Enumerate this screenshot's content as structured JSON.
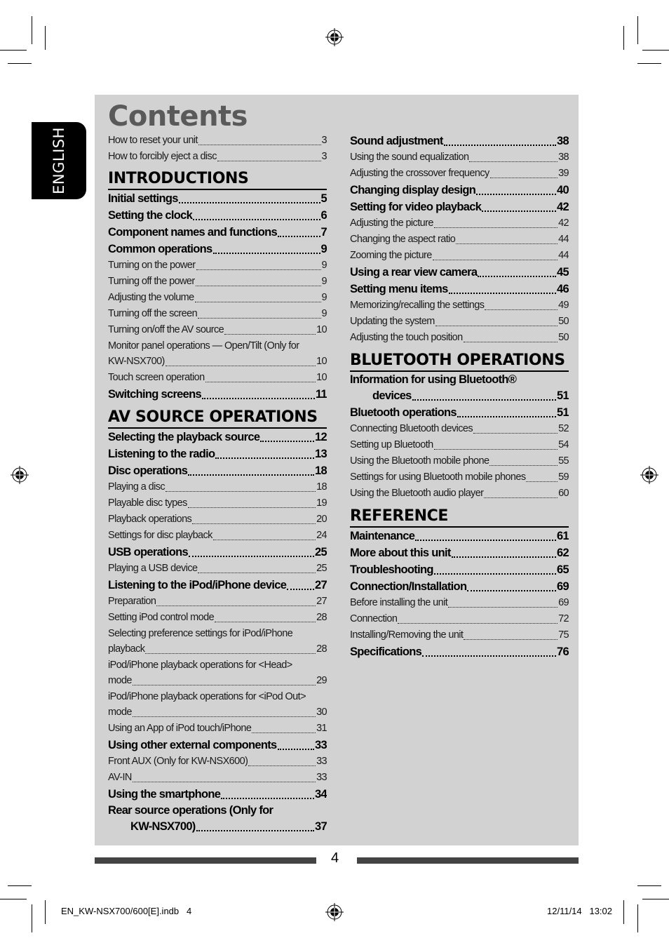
{
  "page": {
    "title": "Contents",
    "language_tab": "ENGLISH",
    "page_number": "4",
    "footer_left": "EN_KW-NSX700/600[E].indb   4",
    "footer_right": "12/11/14   13:02",
    "colors": {
      "panel": "#d2d2d2",
      "title": "#5a5a5a",
      "bar": "#444444",
      "tab": "#000000"
    }
  },
  "left_column": {
    "intro_entries": [
      {
        "label": "How to reset your unit",
        "page": "3",
        "style": "sub"
      },
      {
        "label": "How to forcibly eject a disc",
        "page": "3",
        "style": "sub"
      }
    ],
    "sections": [
      {
        "heading": "INTRODUCTIONS",
        "entries": [
          {
            "label": "Initial settings",
            "page": "5",
            "style": "main"
          },
          {
            "label": "Setting the clock",
            "page": "6",
            "style": "main"
          },
          {
            "label": "Component names and functions",
            "page": "7",
            "style": "main"
          },
          {
            "label": "Common operations",
            "page": "9",
            "style": "main"
          },
          {
            "label": "Turning on the power",
            "page": "9",
            "style": "sub"
          },
          {
            "label": "Turning off the power",
            "page": "9",
            "style": "sub"
          },
          {
            "label": "Adjusting the volume",
            "page": "9",
            "style": "sub"
          },
          {
            "label": "Turning off the screen",
            "page": "9",
            "style": "sub"
          },
          {
            "label": "Turning on/off the AV source",
            "page": "10",
            "style": "sub"
          },
          {
            "label": "Monitor panel operations — Open/Tilt (Only for",
            "page": "",
            "style": "sub-first"
          },
          {
            "label": "KW-NSX700)",
            "page": "10",
            "style": "sub"
          },
          {
            "label": "Touch screen operation",
            "page": "10",
            "style": "sub"
          },
          {
            "label": "Switching screens",
            "page": "11",
            "style": "main"
          }
        ]
      },
      {
        "heading": "AV SOURCE OPERATIONS",
        "entries": [
          {
            "label": "Selecting the playback source",
            "page": "12",
            "style": "main"
          },
          {
            "label": "Listening to the radio",
            "page": "13",
            "style": "main"
          },
          {
            "label": "Disc operations",
            "page": "18",
            "style": "main"
          },
          {
            "label": "Playing a disc",
            "page": "18",
            "style": "sub"
          },
          {
            "label": "Playable disc types",
            "page": "19",
            "style": "sub"
          },
          {
            "label": "Playback operations",
            "page": "20",
            "style": "sub"
          },
          {
            "label": "Settings for disc playback",
            "page": "24",
            "style": "sub"
          },
          {
            "label": "USB operations",
            "page": "25",
            "style": "main"
          },
          {
            "label": "Playing a USB device",
            "page": "25",
            "style": "sub"
          },
          {
            "label": "Listening to the iPod/iPhone device",
            "page": "27",
            "style": "main"
          },
          {
            "label": "Preparation",
            "page": "27",
            "style": "sub"
          },
          {
            "label": "Setting iPod control mode",
            "page": "28",
            "style": "sub"
          },
          {
            "label": "Selecting preference settings for iPod/iPhone",
            "page": "",
            "style": "sub-first"
          },
          {
            "label": "playback",
            "page": "28",
            "style": "sub"
          },
          {
            "label": "iPod/iPhone playback operations for <Head>",
            "page": "",
            "style": "sub-first"
          },
          {
            "label": "mode",
            "page": "29",
            "style": "sub"
          },
          {
            "label": "iPod/iPhone playback operations for <iPod Out>",
            "page": "",
            "style": "sub-first"
          },
          {
            "label": "mode",
            "page": "30",
            "style": "sub"
          },
          {
            "label": "Using an App of iPod touch/iPhone",
            "page": "31",
            "style": "sub"
          },
          {
            "label": "Using other external components",
            "page": "33",
            "style": "main"
          },
          {
            "label": "Front AUX (Only for KW-NSX600)",
            "page": "33",
            "style": "sub"
          },
          {
            "label": "AV-IN",
            "page": "33",
            "style": "sub"
          },
          {
            "label": "Using the smartphone",
            "page": "34",
            "style": "main"
          },
          {
            "label": "Rear source operations (Only for",
            "page": "",
            "style": "main-first"
          },
          {
            "label": "KW-NSX700)",
            "page": "37",
            "style": "main-indent"
          }
        ]
      }
    ]
  },
  "right_column": {
    "top_entries": [
      {
        "label": "Sound adjustment",
        "page": "38",
        "style": "main"
      },
      {
        "label": "Using the sound equalization",
        "page": "38",
        "style": "sub"
      },
      {
        "label": "Adjusting the crossover frequency",
        "page": "39",
        "style": "sub"
      },
      {
        "label": "Changing display design",
        "page": "40",
        "style": "main"
      },
      {
        "label": "Setting for video playback",
        "page": "42",
        "style": "main"
      },
      {
        "label": "Adjusting the picture",
        "page": "42",
        "style": "sub"
      },
      {
        "label": "Changing the aspect ratio",
        "page": "44",
        "style": "sub"
      },
      {
        "label": "Zooming the picture",
        "page": "44",
        "style": "sub"
      },
      {
        "label": "Using a rear view camera",
        "page": "45",
        "style": "main"
      },
      {
        "label": "Setting menu items",
        "page": "46",
        "style": "main"
      },
      {
        "label": "Memorizing/recalling the settings",
        "page": "49",
        "style": "sub"
      },
      {
        "label": "Updating the system",
        "page": "50",
        "style": "sub"
      },
      {
        "label": "Adjusting the touch position",
        "page": "50",
        "style": "sub"
      }
    ],
    "sections": [
      {
        "heading": "BLUETOOTH OPERATIONS",
        "entries": [
          {
            "label": "Information for using Bluetooth®",
            "page": "",
            "style": "main-first"
          },
          {
            "label": "devices",
            "page": "51",
            "style": "main-indent"
          },
          {
            "label": "Bluetooth operations",
            "page": "51",
            "style": "main"
          },
          {
            "label": "Connecting Bluetooth devices",
            "page": "52",
            "style": "sub"
          },
          {
            "label": "Setting up Bluetooth",
            "page": "54",
            "style": "sub"
          },
          {
            "label": "Using the Bluetooth mobile phone",
            "page": "55",
            "style": "sub"
          },
          {
            "label": "Settings for using Bluetooth mobile phones",
            "page": "59",
            "style": "sub"
          },
          {
            "label": "Using the Bluetooth audio player",
            "page": "60",
            "style": "sub"
          }
        ]
      },
      {
        "heading": "REFERENCE",
        "entries": [
          {
            "label": "Maintenance",
            "page": "61",
            "style": "main"
          },
          {
            "label": "More about this unit",
            "page": "62",
            "style": "main"
          },
          {
            "label": "Troubleshooting",
            "page": "65",
            "style": "main"
          },
          {
            "label": "Connection/Installation",
            "page": "69",
            "style": "main"
          },
          {
            "label": "Before installing the unit",
            "page": "69",
            "style": "sub"
          },
          {
            "label": "Connection",
            "page": "72",
            "style": "sub"
          },
          {
            "label": "Installing/Removing the unit",
            "page": "75",
            "style": "sub"
          },
          {
            "label": "Specifications",
            "page": "76",
            "style": "main"
          }
        ]
      }
    ]
  }
}
